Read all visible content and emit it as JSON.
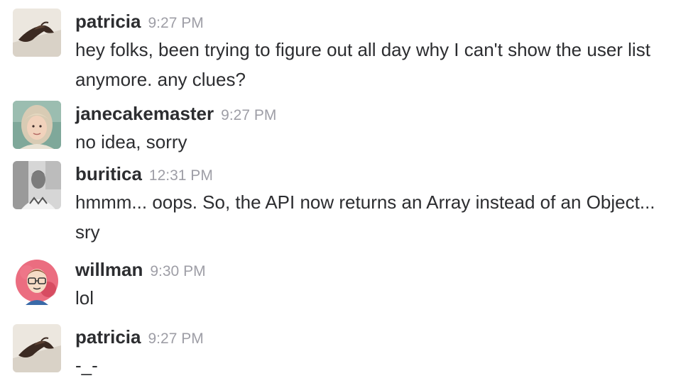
{
  "messages": [
    {
      "user": "patricia",
      "time": "9:27 PM",
      "avatar_icon": "moth-photo-avatar",
      "text": "hey folks, been trying to figure out all day why I can't show the user list anymore. any clues?"
    },
    {
      "user": "janecakemaster",
      "time": "9:27 PM",
      "avatar_icon": "woman-photo-avatar",
      "text": "no idea, sorry"
    },
    {
      "user": "buritica",
      "time": "12:31 PM",
      "avatar_icon": "man-bw-photo-avatar",
      "text": "hmmm... oops. So, the API now returns an Array instead of an Object... sry"
    },
    {
      "user": "willman",
      "time": "9:30 PM",
      "avatar_icon": "cartoon-glasses-avatar",
      "text": "lol"
    },
    {
      "user": "patricia",
      "time": "9:27 PM",
      "avatar_icon": "moth-photo-avatar",
      "text": "-_-"
    }
  ],
  "colors": {
    "username": "#2c2d30",
    "timestamp": "#9e9ea6",
    "text": "#2c2d30"
  }
}
